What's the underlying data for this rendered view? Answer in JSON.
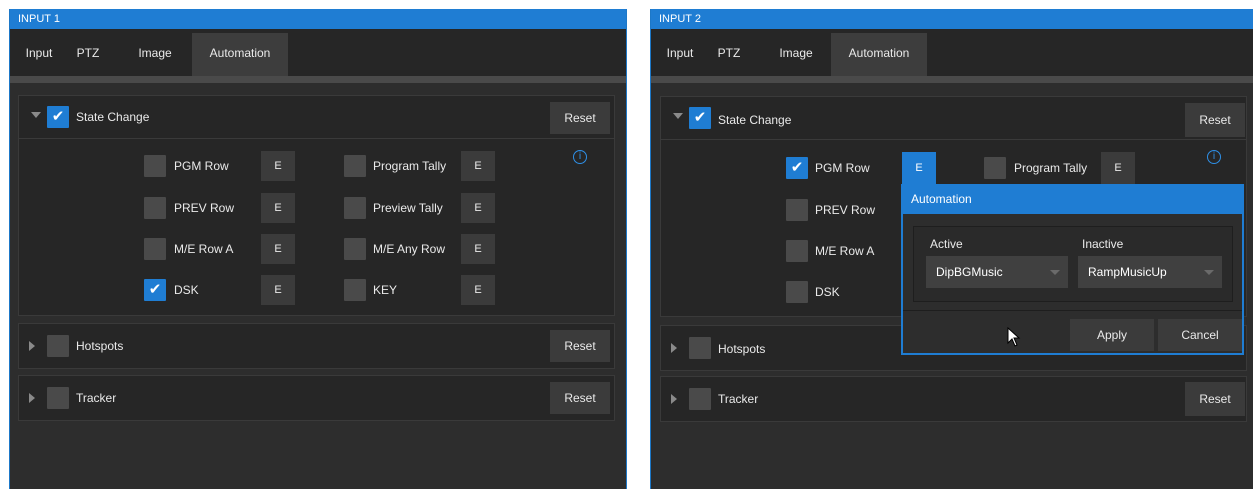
{
  "panel1": {
    "title": "INPUT 1",
    "tabs": [
      "Input",
      "PTZ",
      "Image",
      "Automation"
    ],
    "state_change": {
      "label": "State Change",
      "checked": true,
      "reset": "Reset",
      "rows": [
        {
          "left": {
            "label": "PGM Row",
            "checked": false,
            "e": "E"
          },
          "right": {
            "label": "Program Tally",
            "checked": false,
            "e": "E"
          }
        },
        {
          "left": {
            "label": "PREV Row",
            "checked": false,
            "e": "E"
          },
          "right": {
            "label": "Preview Tally",
            "checked": false,
            "e": "E"
          }
        },
        {
          "left": {
            "label": "M/E Row A",
            "checked": false,
            "e": "E"
          },
          "right": {
            "label": "M/E Any Row",
            "checked": false,
            "e": "E"
          }
        },
        {
          "left": {
            "label": "DSK",
            "checked": true,
            "e": "E"
          },
          "right": {
            "label": "KEY",
            "checked": false,
            "e": "E"
          }
        }
      ],
      "info_icon": "i"
    },
    "hotspots": {
      "label": "Hotspots",
      "reset": "Reset"
    },
    "tracker": {
      "label": "Tracker",
      "reset": "Reset"
    }
  },
  "panel2": {
    "title": "INPUT 2",
    "tabs": [
      "Input",
      "PTZ",
      "Image",
      "Automation"
    ],
    "state_change": {
      "label": "State Change",
      "checked": true,
      "reset": "Reset",
      "rows": [
        {
          "left": {
            "label": "PGM Row",
            "checked": true,
            "e": "E"
          },
          "right": {
            "label": "Program Tally",
            "checked": false,
            "e": "E"
          }
        },
        {
          "left": {
            "label": "PREV Row",
            "checked": false
          }
        },
        {
          "left": {
            "label": "M/E Row A",
            "checked": false
          }
        },
        {
          "left": {
            "label": "DSK",
            "checked": false
          }
        }
      ],
      "info_icon": "i"
    },
    "hotspots": {
      "label": "Hotspots"
    },
    "tracker": {
      "label": "Tracker",
      "reset": "Reset"
    }
  },
  "automation_popup": {
    "title": "Automation",
    "active_label": "Active",
    "inactive_label": "Inactive",
    "active_value": "DipBGMusic",
    "inactive_value": "RampMusicUp",
    "apply": "Apply",
    "cancel": "Cancel"
  },
  "colors": {
    "accent": "#1f7dd3",
    "panel_bg": "#2d2d2d",
    "section_bg": "#262626"
  }
}
